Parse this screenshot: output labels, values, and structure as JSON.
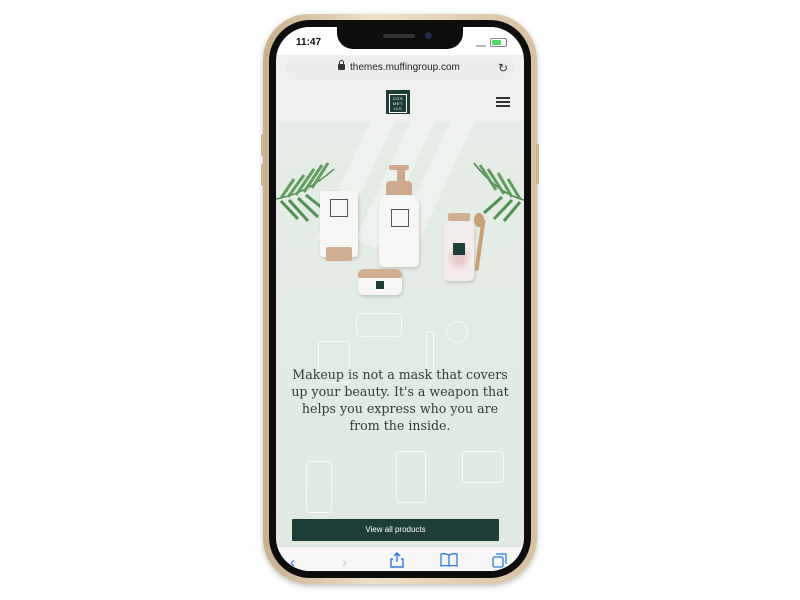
{
  "status_bar": {
    "time": "11:47"
  },
  "browser": {
    "url": "themes.muffingroup.com"
  },
  "site": {
    "logo_text": [
      "COS",
      "MET",
      "ICS"
    ],
    "quote": "Makeup is not a mask that covers up your beauty. It's a weapon that helps you express who you are from the inside.",
    "cta_label": "View all products"
  },
  "icons": {
    "lock": "lock-icon",
    "reload": "reload-icon",
    "menu": "hamburger-menu-icon",
    "back": "chevron-left-icon",
    "forward": "chevron-right-icon",
    "share": "share-icon",
    "bookmarks": "open-book-icon",
    "tabs": "tabs-icon"
  },
  "colors": {
    "brand": "#1d3d37",
    "background": "#e6ece7",
    "toolbar_accent": "#2a7be4"
  }
}
